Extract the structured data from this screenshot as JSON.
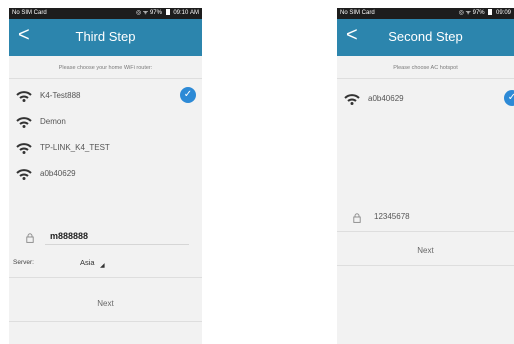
{
  "left_screen": {
    "status_bar": {
      "carrier": "No SIM Card",
      "right": "97%",
      "time": "09:10 AM"
    },
    "header": {
      "title": "Third Step",
      "back_glyph": "<"
    },
    "prompt": "Please choose your home WiFi router:",
    "networks": [
      {
        "ssid": "K4-Test888",
        "selected": true
      },
      {
        "ssid": "Demon",
        "selected": false
      },
      {
        "ssid": "TP-LINK_K4_TEST",
        "selected": false
      },
      {
        "ssid": "a0b40629",
        "selected": false
      }
    ],
    "password": {
      "value": "m888888",
      "icon": "lock-icon"
    },
    "server": {
      "label": "Server:",
      "value": "Asia"
    },
    "next_label": "Next"
  },
  "right_screen": {
    "status_bar": {
      "carrier": "No SIM Card",
      "right": "97%",
      "time": "09:09"
    },
    "header": {
      "title": "Second Step",
      "back_glyph": "<"
    },
    "prompt": "Please choose AC hotspot",
    "networks": [
      {
        "ssid": "a0b40629",
        "selected": true
      }
    ],
    "password": {
      "value": "12345678",
      "icon": "lock-icon"
    },
    "next_label": "Next"
  },
  "colors": {
    "header": "#2c85ad",
    "status_bar": "#1d1d1d",
    "background": "#f2f2f2",
    "check": "#2d8ad6"
  }
}
